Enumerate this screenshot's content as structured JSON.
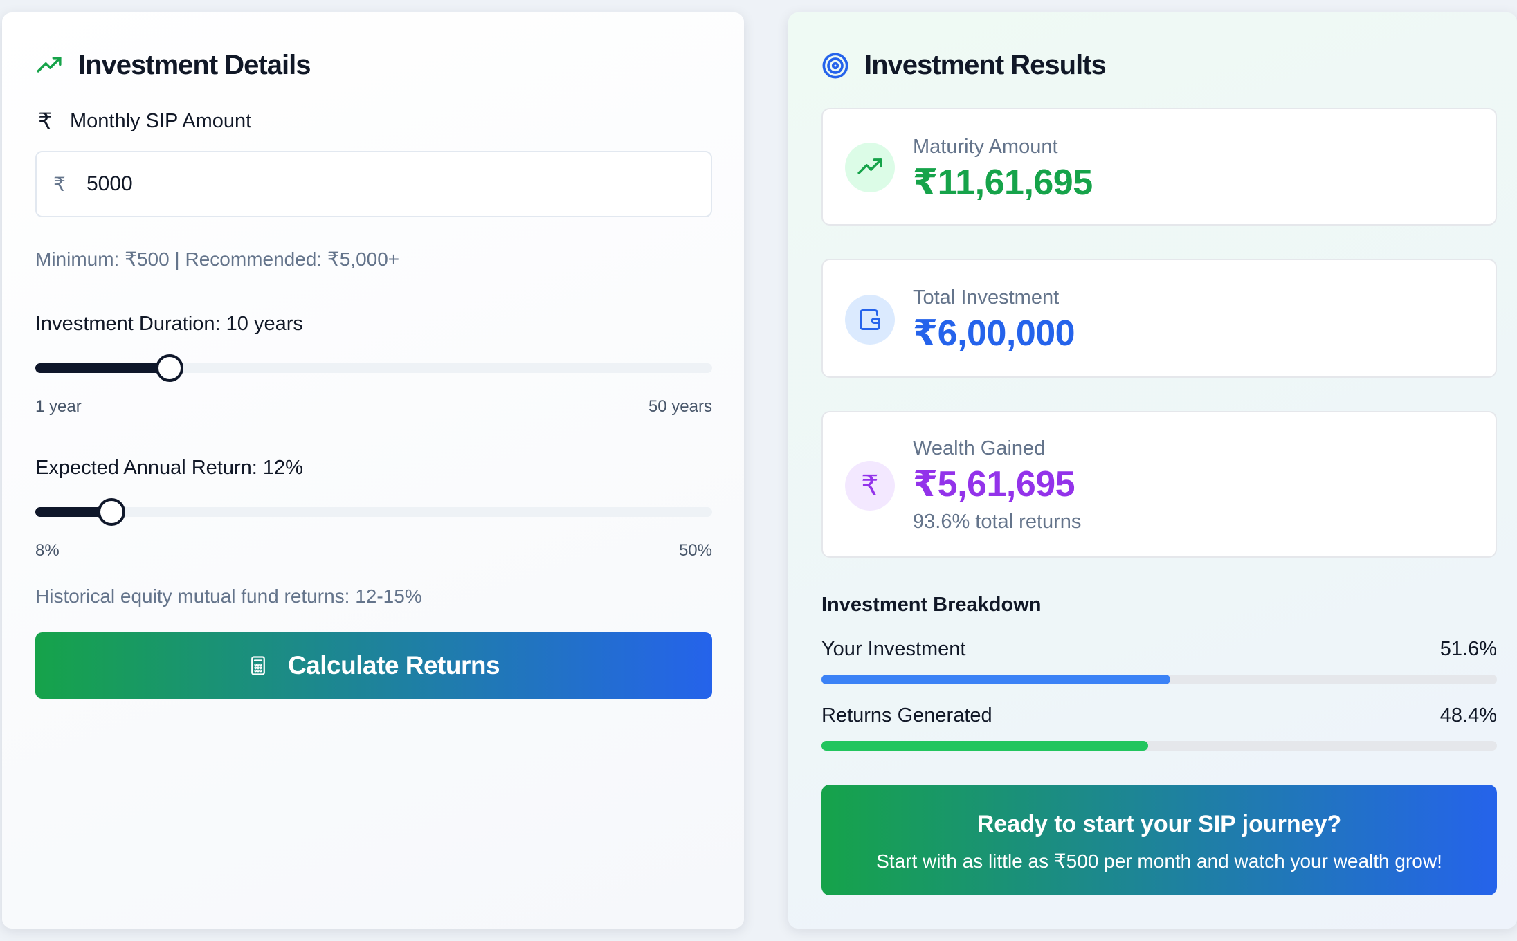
{
  "details": {
    "title": "Investment Details",
    "sip_label": "Monthly SIP Amount",
    "currency_symbol": "₹",
    "amount_value": "5000",
    "amount_hint": "Minimum: ₹500 | Recommended: ₹5,000+",
    "duration": {
      "label": "Investment Duration: 10 years",
      "value": 10,
      "min": 1,
      "max": 50,
      "min_label": "1 year",
      "max_label": "50 years"
    },
    "return_rate": {
      "label": "Expected Annual Return: 12%",
      "value": 12,
      "min": 8,
      "max": 50,
      "min_label": "8%",
      "max_label": "50%"
    },
    "historical_note": "Historical equity mutual fund returns: 12-15%",
    "calculate_label": "Calculate Returns"
  },
  "results": {
    "title": "Investment Results",
    "maturity": {
      "label": "Maturity Amount",
      "value": "₹11,61,695",
      "color": "#16a34a"
    },
    "total_investment": {
      "label": "Total Investment",
      "value": "₹6,00,000",
      "color": "#2563eb"
    },
    "wealth_gained": {
      "label": "Wealth Gained",
      "value": "₹5,61,695",
      "color": "#9333ea",
      "sub": "93.6% total returns",
      "symbol": "₹"
    },
    "breakdown": {
      "title": "Investment Breakdown",
      "items": [
        {
          "label": "Your Investment",
          "percent_label": "51.6%",
          "percent": 51.6,
          "color": "#3b82f6"
        },
        {
          "label": "Returns Generated",
          "percent_label": "48.4%",
          "percent": 48.4,
          "color": "#22c55e"
        }
      ]
    },
    "cta": {
      "title": "Ready to start your SIP journey?",
      "text": "Start with as little as ₹500 per month and watch your wealth grow!"
    }
  }
}
